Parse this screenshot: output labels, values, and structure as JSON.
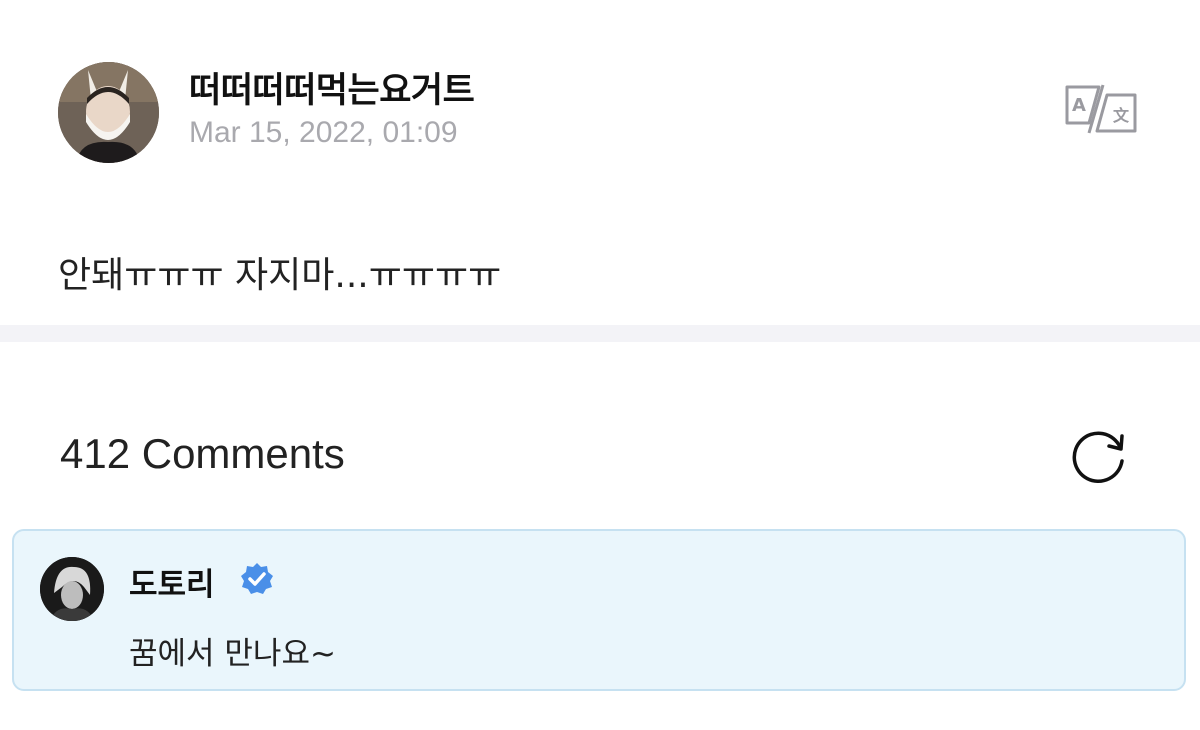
{
  "post": {
    "author": "떠떠떠떠먹는요거트",
    "date": "Mar 15, 2022, 01:09",
    "body": "안돼ㅠㅠㅠ 자지마...ㅠㅠㅠㅠ",
    "avatar_icon": "user-avatar-photo",
    "translate_icon": "translate-icon"
  },
  "comments": {
    "header": "412 Comments",
    "refresh_icon": "refresh-icon",
    "highlighted": {
      "author": "도토리",
      "verified": true,
      "verified_color": "#4a8fe8",
      "text": "꿈에서 만나요~",
      "avatar_icon": "user-avatar-photo"
    }
  },
  "colors": {
    "divider": "#f3f3f7",
    "highlight_bg": "#eaf6fc",
    "highlight_border": "#c6e1f1",
    "muted_text": "#a9a9ae"
  }
}
